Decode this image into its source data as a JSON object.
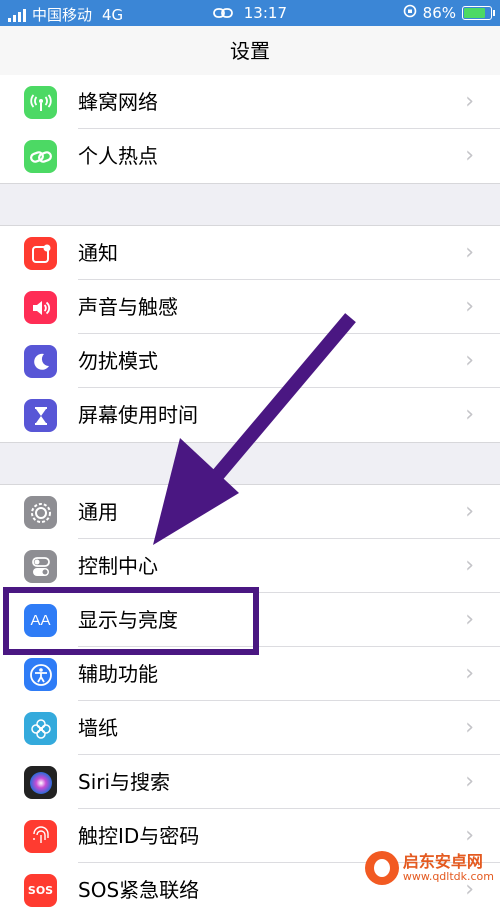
{
  "status": {
    "carrier": "中国移动",
    "network": "4G",
    "time": "13:17",
    "battery": "86%",
    "battery_level": 0.86
  },
  "nav": {
    "title": "设置"
  },
  "groups": [
    [
      {
        "label": "蜂窝网络",
        "icon": "cellular-antenna-icon",
        "color": "#4cd964"
      },
      {
        "label": "个人热点",
        "icon": "hotspot-link-icon",
        "color": "#4cd964"
      }
    ],
    [
      {
        "label": "通知",
        "icon": "notification-icon",
        "color": "#ff3b30"
      },
      {
        "label": "声音与触感",
        "icon": "speaker-icon",
        "color": "#ff2d55"
      },
      {
        "label": "勿扰模式",
        "icon": "moon-icon",
        "color": "#5856d6"
      },
      {
        "label": "屏幕使用时间",
        "icon": "hourglass-icon",
        "color": "#5856d6"
      }
    ],
    [
      {
        "label": "通用",
        "icon": "gear-icon",
        "color": "#8e8e93"
      },
      {
        "label": "控制中心",
        "icon": "toggles-icon",
        "color": "#8e8e93"
      },
      {
        "label": "显示与亮度",
        "icon": "text-size-icon",
        "color": "#2f7cf6"
      },
      {
        "label": "辅助功能",
        "icon": "accessibility-icon",
        "color": "#2f7cf6"
      },
      {
        "label": "墙纸",
        "icon": "flower-icon",
        "color": "#34aadc"
      },
      {
        "label": "Siri与搜索",
        "icon": "siri-icon",
        "color": "#222222"
      },
      {
        "label": "触控ID与密码",
        "icon": "fingerprint-icon",
        "color": "#ff3b30"
      },
      {
        "label": "SOS紧急联络",
        "icon": "sos-icon",
        "color": "#ff3b30"
      }
    ]
  ],
  "watermark": {
    "name": "启东安卓网",
    "url": "www.qdltdk.com"
  }
}
